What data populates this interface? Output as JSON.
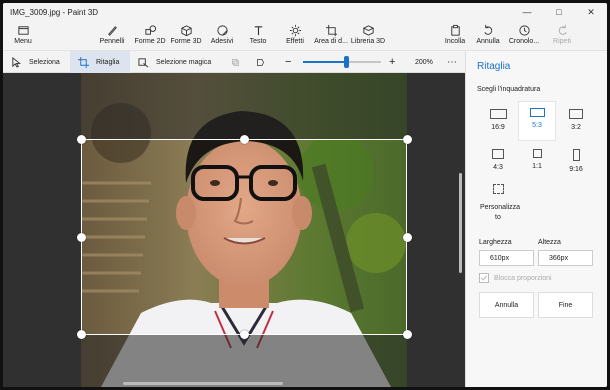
{
  "window": {
    "title": "IMG_3009.jpg - Paint 3D"
  },
  "toolbar": {
    "menu": "Menu",
    "pennelli": "Pennelli",
    "forme2d": "Forme 2D",
    "forme3d": "Forme 3D",
    "adesivi": "Adesivi",
    "testo": "Testo",
    "effetti": "Effetti",
    "area": "Area di d...",
    "libreria": "Libreria 3D",
    "incolla": "Incolla",
    "annulla": "Annulla",
    "cronologia": "Cronolo...",
    "ripeti": "Ripeti"
  },
  "subbar": {
    "seleziona": "Seleziona",
    "ritaglia": "Ritaglia",
    "magica": "Selezione magica",
    "zoom": "200%",
    "zoom_level": 0.55
  },
  "panel": {
    "title": "Ritaglia",
    "section": "Scegli l'inquadratura",
    "ratios": [
      "16:9",
      "5:3",
      "3:2",
      "4:3",
      "1:1",
      "9:16"
    ],
    "selected_ratio": "5:3",
    "custom_label_1": "Personalizza",
    "custom_label_2": "to",
    "width_label": "Larghezza",
    "height_label": "Altezza",
    "width_value": "610px",
    "height_value": "366px",
    "lock_label": "Blocca proporzioni",
    "cancel": "Annulla",
    "done": "Fine"
  },
  "colors": {
    "accent": "#1a73c6"
  }
}
